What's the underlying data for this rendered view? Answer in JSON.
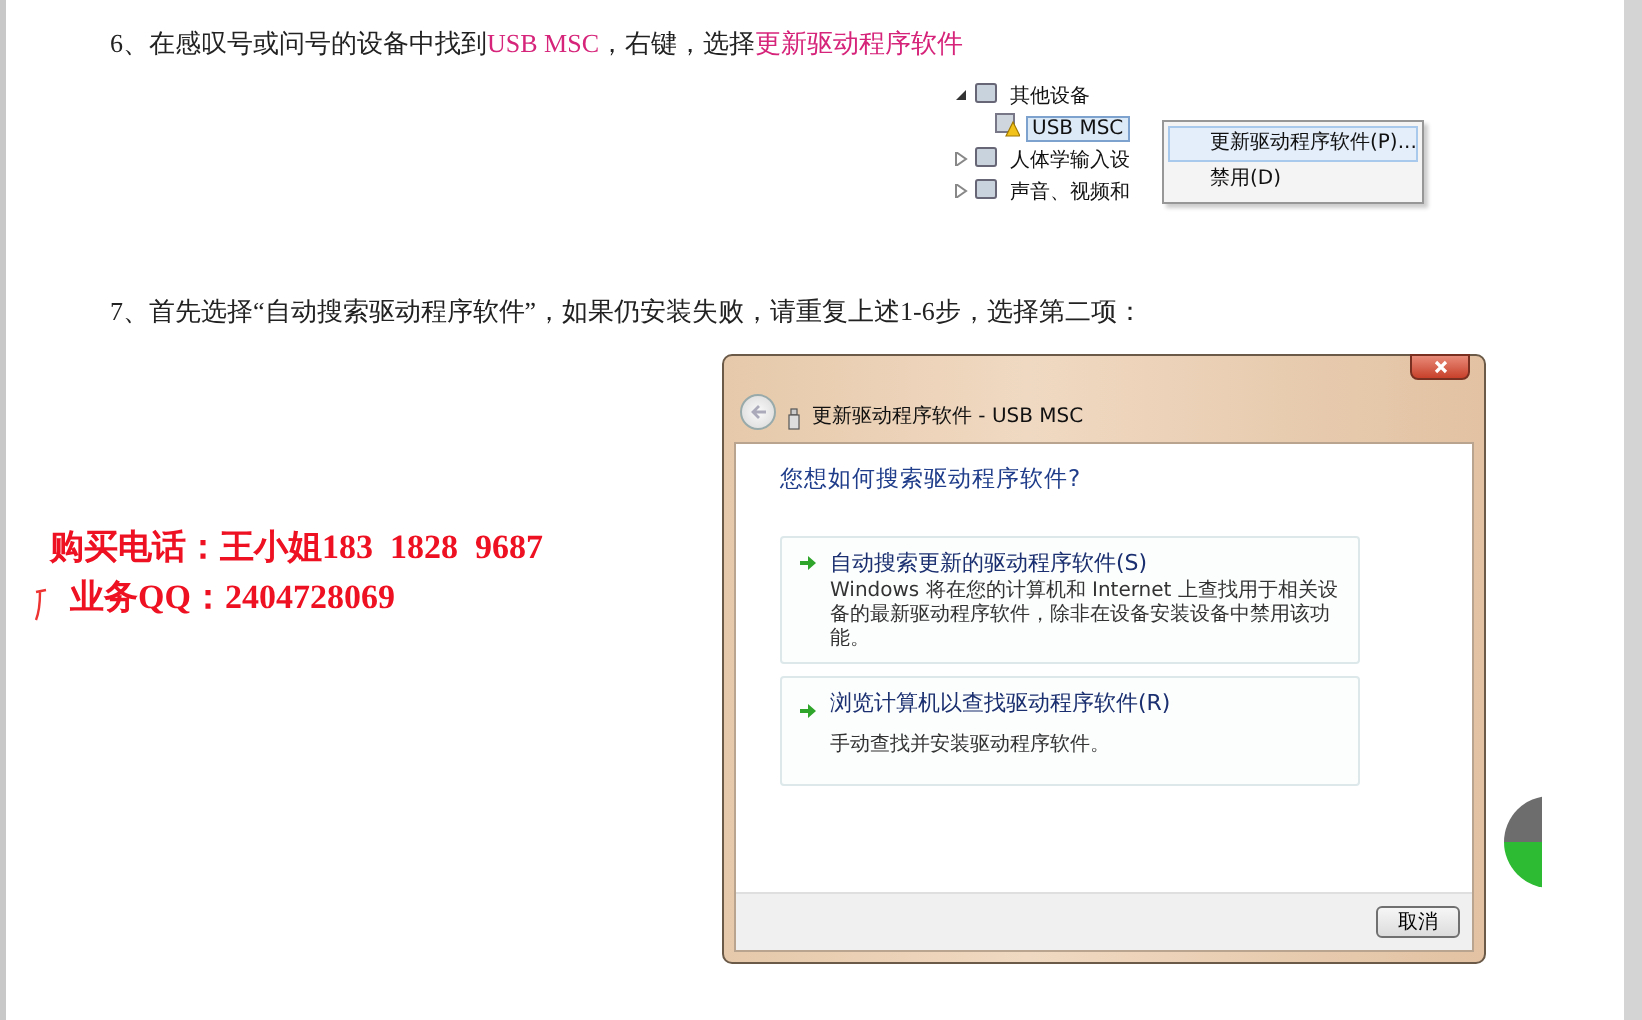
{
  "steps": [
    {
      "number": "6、",
      "segments": [
        {
          "text": "在感叹号或问号的设备中找到",
          "highlight": false
        },
        {
          "text": "USB MSC",
          "highlight": true
        },
        {
          "text": "，右键，选择",
          "highlight": false
        },
        {
          "text": "更新驱动程序软件",
          "highlight": true
        }
      ]
    },
    {
      "number": "7、",
      "segments": [
        {
          "text": "首先选择“自动搜索驱动程序软件”，如果仍安装失败，请重复上述1-6步，选择第二项：",
          "highlight": false
        }
      ]
    }
  ],
  "device_tree": {
    "items": [
      {
        "label": "其他设备",
        "expanded": true,
        "children": [
          {
            "label": "USB MSC",
            "selected": true
          }
        ]
      },
      {
        "label": "人体学输入设",
        "expanded": false
      },
      {
        "label": "声音、视频和",
        "expanded": false
      }
    ]
  },
  "context_menu": {
    "items": [
      {
        "label": "更新驱动程序软件(P)...",
        "selected": true
      },
      {
        "label": "禁用(D)",
        "selected": false
      }
    ]
  },
  "contact": {
    "lines": [
      "购买电话：王小姐183  1828  9687",
      "业务QQ：2404728069"
    ]
  },
  "dialog": {
    "title": "更新驱动程序软件 - USB MSC",
    "heading": "您想如何搜索驱动程序软件?",
    "options": [
      {
        "title": "自动搜索更新的驱动程序软件(S)",
        "description": "Windows 将在您的计算机和 Internet 上查找用于相关设备的最新驱动程序软件，除非在设备安装设备中禁用该功能。"
      },
      {
        "title": "浏览计算机以查找驱动程序软件(R)",
        "description": "手动查找并安装驱动程序软件。"
      }
    ],
    "buttons": [
      "取消"
    ]
  }
}
